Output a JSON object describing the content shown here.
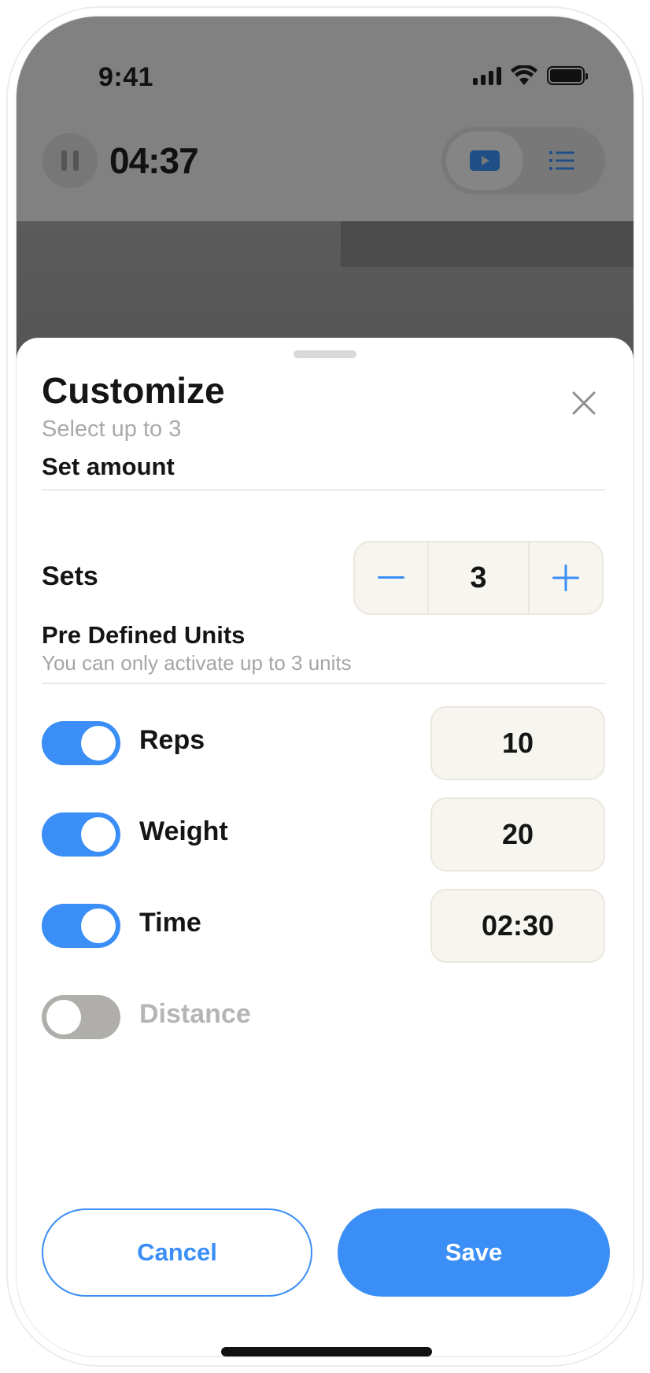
{
  "status_bar": {
    "time": "9:41",
    "icons": [
      "cellular-signal-icon",
      "wifi-icon",
      "battery-icon"
    ]
  },
  "workout_header": {
    "timer": "04:37",
    "pause_icon": "pause-icon",
    "view_toggle": [
      {
        "icon": "video-icon",
        "active": true
      },
      {
        "icon": "list-icon",
        "active": false
      }
    ]
  },
  "sheet": {
    "title": "Customize",
    "subtitle": "Select up to 3",
    "close_icon": "close-icon",
    "set_amount": {
      "label": "Set amount",
      "sets_label": "Sets",
      "sets_value": "3",
      "decrement_icon": "minus-icon",
      "increment_icon": "plus-icon"
    },
    "units_section": {
      "label": "Pre Defined Units",
      "hint": "You can only activate up to 3 units"
    },
    "units": [
      {
        "label": "Reps",
        "enabled": true,
        "value": "10"
      },
      {
        "label": "Weight",
        "enabled": true,
        "value": "20"
      },
      {
        "label": "Time",
        "enabled": true,
        "value": "02:30"
      },
      {
        "label": "Distance",
        "enabled": false,
        "value": ""
      }
    ],
    "actions": {
      "cancel": "Cancel",
      "save": "Save"
    }
  },
  "colors": {
    "accent": "#3a8ef5",
    "field_bg": "#f7f5f0",
    "toggle_off": "#b0aeab",
    "muted_text": "#a9a9a9"
  }
}
